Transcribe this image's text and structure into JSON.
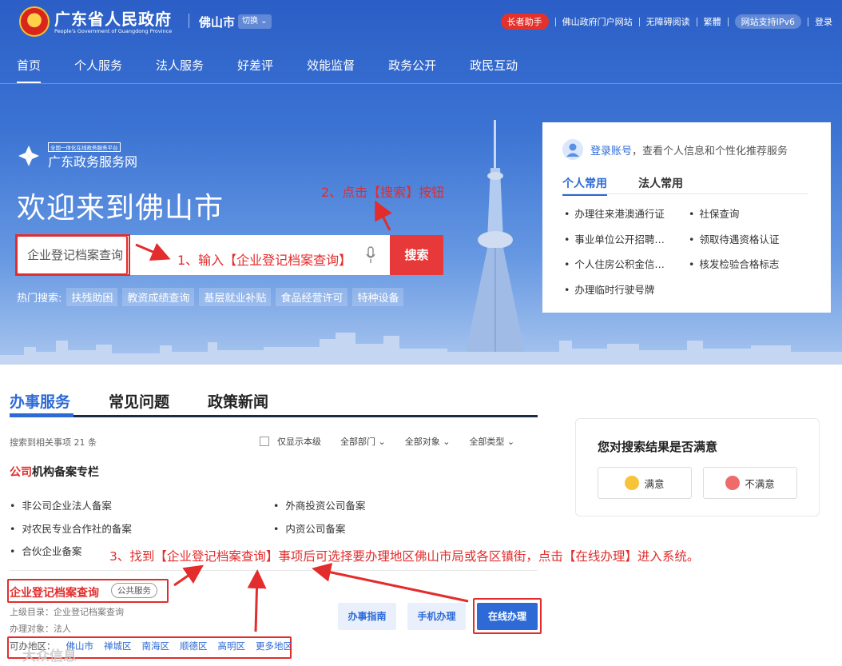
{
  "header": {
    "gov_title": "广东省人民政府",
    "gov_subtitle": "People's Government of Guangdong Province",
    "city": "佛山市",
    "city_switch": "切换 ⌄",
    "elder_helper": "长者助手",
    "links": [
      "佛山政府门户网站",
      "无障碍阅读",
      "繁體",
      "网站支持IPv6",
      "登录"
    ]
  },
  "nav": [
    "首页",
    "个人服务",
    "法人服务",
    "好差评",
    "效能监督",
    "政务公开",
    "政民互动"
  ],
  "platform": {
    "small_label": "全国一体化在线政务服务平台",
    "name": "广东政务服务网"
  },
  "welcome": "欢迎来到佛山市",
  "search": {
    "value": "企业登记档案查询",
    "button": "搜索",
    "hot_label": "热门搜索:",
    "hot_tags": [
      "扶残助困",
      "教资成绩查询",
      "基层就业补贴",
      "食品经营许可",
      "特种设备"
    ]
  },
  "annotations": {
    "step1": "1、输入【企业登记档案查询】",
    "step2": "2、点击【搜索】按钮",
    "step3": "3、找到【企业登记档案查询】事项后可选择要办理地区佛山市局或各区镇街，点击【在线办理】进入系统。"
  },
  "panel": {
    "login_link": "登录账号",
    "login_text": "，查看个人信息和个性化推荐服务",
    "tabs": [
      "个人常用",
      "法人常用"
    ],
    "items": [
      "办理往来港澳通行证",
      "社保查询",
      "事业单位公开招聘…",
      "领取待遇资格认证",
      "个人住房公积金信…",
      "核发检验合格标志",
      "办理临时行驶号牌"
    ]
  },
  "results": {
    "tabs": [
      "办事服务",
      "常见问题",
      "政策新闻"
    ],
    "count": "搜索到相关事项 21 条",
    "only_local": "仅显示本级",
    "filters": [
      "全部部门 ⌄",
      "全部对象 ⌄",
      "全部类型 ⌄"
    ],
    "column_title_hl": "公司",
    "column_title": "机构备案专栏",
    "column_items": [
      "非公司企业法人备案",
      "外商投资公司备案",
      "对农民专业合作社的备案",
      "内资公司备案",
      "合伙企业备案"
    ],
    "item": {
      "name": "企业登记档案查询",
      "badge": "公共服务",
      "parent": "上级目录：企业登记档案查询",
      "target": "办理对象：法人",
      "areas_label": "可办地区：",
      "areas": [
        "佛山市",
        "禅城区",
        "南海区",
        "顺德区",
        "高明区",
        "更多地区"
      ],
      "buttons": [
        "办事指南",
        "手机办理",
        "在线办理"
      ]
    }
  },
  "survey": {
    "title": "您对搜索结果是否满意",
    "good": "满意",
    "bad": "不满意"
  },
  "watermark": "大众信息",
  "colors": {
    "accent": "#2d6ad6",
    "red": "#e32c2c",
    "hero": "#3b73d3"
  }
}
